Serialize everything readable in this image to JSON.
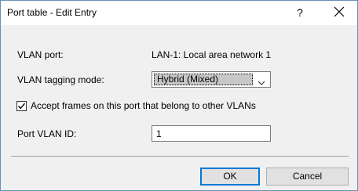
{
  "window": {
    "title": "Port table - Edit Entry",
    "help_label": "?"
  },
  "fields": {
    "vlan_port_label": "VLAN port:",
    "vlan_port_value": "LAN-1: Local area network 1",
    "tagging_mode_label": "VLAN tagging mode:",
    "tagging_mode_value": "Hybrid (Mixed)",
    "accept_frames_label": "Accept frames on this port that belong to other VLANs",
    "accept_frames_checked": true,
    "port_vlan_id_label": "Port VLAN ID:",
    "port_vlan_id_value": "1"
  },
  "buttons": {
    "ok_label": "OK",
    "cancel_label": "Cancel"
  },
  "colors": {
    "window_border": "#6b8fb4",
    "dialog_background": "#f0f0f0",
    "default_button_border": "#0078d7"
  }
}
